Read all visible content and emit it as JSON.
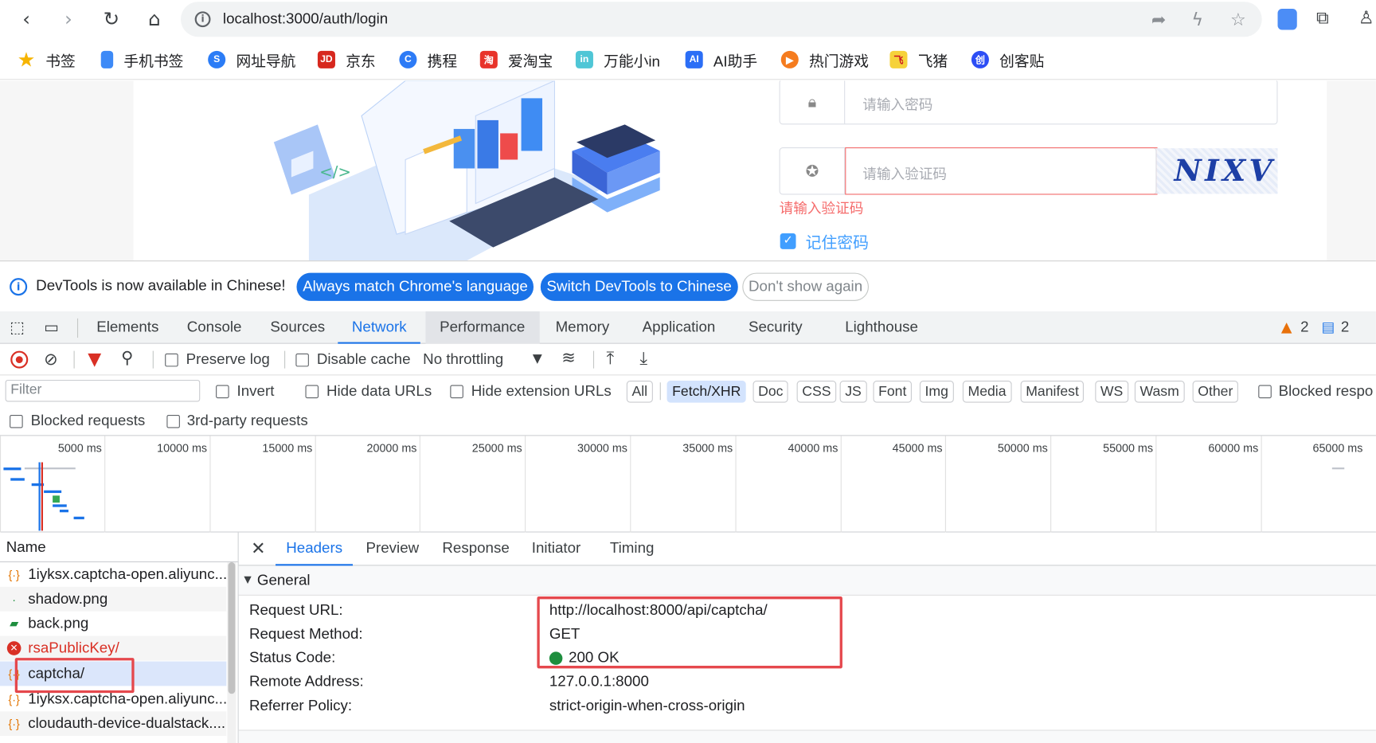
{
  "browser": {
    "url": "localhost:3000/auth/login",
    "bookmarks": [
      "书签",
      "手机书签",
      "网址导航",
      "京东",
      "携程",
      "爱淘宝",
      "万能小in",
      "AI助手",
      "热门游戏",
      "飞猪",
      "创客贴"
    ]
  },
  "login": {
    "password_placeholder": "请输入密码",
    "captcha_placeholder": "请输入验证码",
    "captcha_error": "请输入验证码",
    "remember_label": "记住密码",
    "captcha_image_text": "NIXV"
  },
  "banner": {
    "text": "DevTools is now available in Chinese!",
    "btn_match": "Always match Chrome's language",
    "btn_switch": "Switch DevTools to Chinese",
    "btn_dont": "Don't show again"
  },
  "devtools": {
    "tabs": [
      "Elements",
      "Console",
      "Sources",
      "Network",
      "Performance",
      "Memory",
      "Application",
      "Security",
      "Lighthouse"
    ],
    "warnings": "2",
    "messages": "2",
    "toolbar": {
      "preserve_log": "Preserve log",
      "disable_cache": "Disable cache",
      "throttling": "No throttling"
    },
    "filter": {
      "placeholder": "Filter",
      "invert": "Invert",
      "hide_data": "Hide data URLs",
      "hide_ext": "Hide extension URLs",
      "types": [
        "All",
        "Fetch/XHR",
        "Doc",
        "CSS",
        "JS",
        "Font",
        "Img",
        "Media",
        "Manifest",
        "WS",
        "Wasm",
        "Other"
      ],
      "blocked_resp": "Blocked respo",
      "blocked_req": "Blocked requests",
      "third_party": "3rd-party requests"
    },
    "timeline_ticks": [
      "5000 ms",
      "10000 ms",
      "15000 ms",
      "20000 ms",
      "25000 ms",
      "30000 ms",
      "35000 ms",
      "40000 ms",
      "45000 ms",
      "50000 ms",
      "55000 ms",
      "60000 ms",
      "65000 ms"
    ],
    "list_header": "Name",
    "requests": [
      {
        "name": "1iyksx.captcha-open.aliyunc...",
        "icon": "xhr-icon",
        "status": "ok"
      },
      {
        "name": "shadow.png",
        "icon": "image-dot-icon",
        "status": "ok"
      },
      {
        "name": "back.png",
        "icon": "image-icon",
        "status": "ok"
      },
      {
        "name": "rsaPublicKey/",
        "icon": "error-icon",
        "status": "error"
      },
      {
        "name": "captcha/",
        "icon": "xhr-icon",
        "status": "selected"
      },
      {
        "name": "1iyksx.captcha-open.aliyunc...",
        "icon": "xhr-icon",
        "status": "ok"
      },
      {
        "name": "cloudauth-device-dualstack....",
        "icon": "xhr-icon",
        "status": "ok"
      }
    ],
    "detail_tabs": [
      "Headers",
      "Preview",
      "Response",
      "Initiator",
      "Timing"
    ],
    "general_title": "General",
    "general": [
      {
        "key": "Request URL:",
        "value": "http://localhost:8000/api/captcha/"
      },
      {
        "key": "Request Method:",
        "value": "GET"
      },
      {
        "key": "Status Code:",
        "value": "200 OK"
      },
      {
        "key": "Remote Address:",
        "value": "127.0.0.1:8000"
      },
      {
        "key": "Referrer Policy:",
        "value": "strict-origin-when-cross-origin"
      }
    ]
  },
  "colors": {
    "accent": "#1a73e8",
    "error": "#d93025",
    "highlight": "#e5484d",
    "success": "#1e8e3e"
  }
}
